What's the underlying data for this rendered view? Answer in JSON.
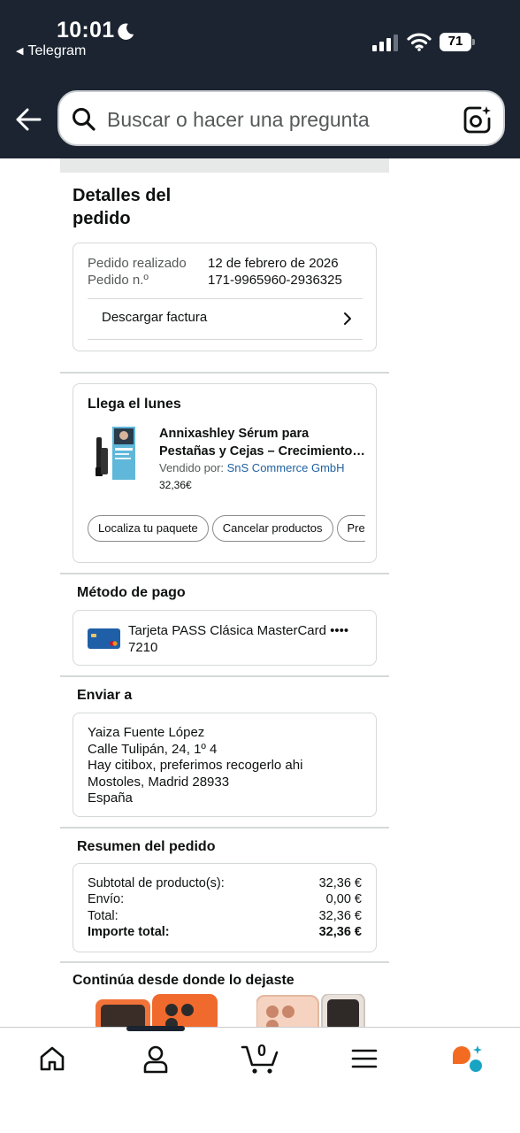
{
  "status_bar": {
    "time": "10:01",
    "back_app": "Telegram",
    "battery": "71"
  },
  "search": {
    "placeholder": "Buscar o hacer una pregunta"
  },
  "order_details": {
    "title": "Detalles del pedido",
    "placed_label": "Pedido realizado",
    "placed_value": "12 de febrero de 2026",
    "number_label": "Pedido n.º",
    "number_value": "171-9965960-2936325",
    "invoice_label": "Descargar factura"
  },
  "delivery": {
    "title": "Llega el lunes",
    "product_name_line1": "Annixashley Sérum para",
    "product_name_line2": "Pestañas y Cejas – Crecimiento…",
    "seller_prefix": "Vendido por: ",
    "seller_name": "SnS Commerce GmbH",
    "price": "32,36€",
    "actions": [
      "Localiza tu paquete",
      "Cancelar productos",
      "Pre"
    ]
  },
  "payment": {
    "title": "Método de pago",
    "card_line1": "Tarjeta PASS Clásica MasterCard ••••",
    "card_line2": "7210"
  },
  "shipping": {
    "title": "Enviar a",
    "lines": [
      "Yaiza Fuente López",
      "Calle Tulipán, 24, 1º 4",
      "Hay citibox, preferimos recogerlo ahi",
      "Mostoles, Madrid 28933",
      "España"
    ]
  },
  "summary": {
    "title": "Resumen del pedido",
    "rows": [
      {
        "label": "Subtotal de producto(s):",
        "value": "32,36 €"
      },
      {
        "label": "Envío:",
        "value": "0,00 €"
      },
      {
        "label": "Total:",
        "value": "32,36 €"
      },
      {
        "label": "Importe total:",
        "value": "32,36 €"
      }
    ]
  },
  "continue": {
    "title": "Continúa desde donde lo dejaste"
  },
  "bottom_nav": {
    "cart_count": "0",
    "items": [
      "home-icon",
      "account-icon",
      "cart-icon",
      "menu-icon",
      "rufus-icon"
    ]
  },
  "colors": {
    "header_bg": "#1b2430",
    "link": "#2162a1",
    "border": "#d5d9d9",
    "rufus_orange": "#f36b21",
    "rufus_teal": "#1aa4c4"
  }
}
